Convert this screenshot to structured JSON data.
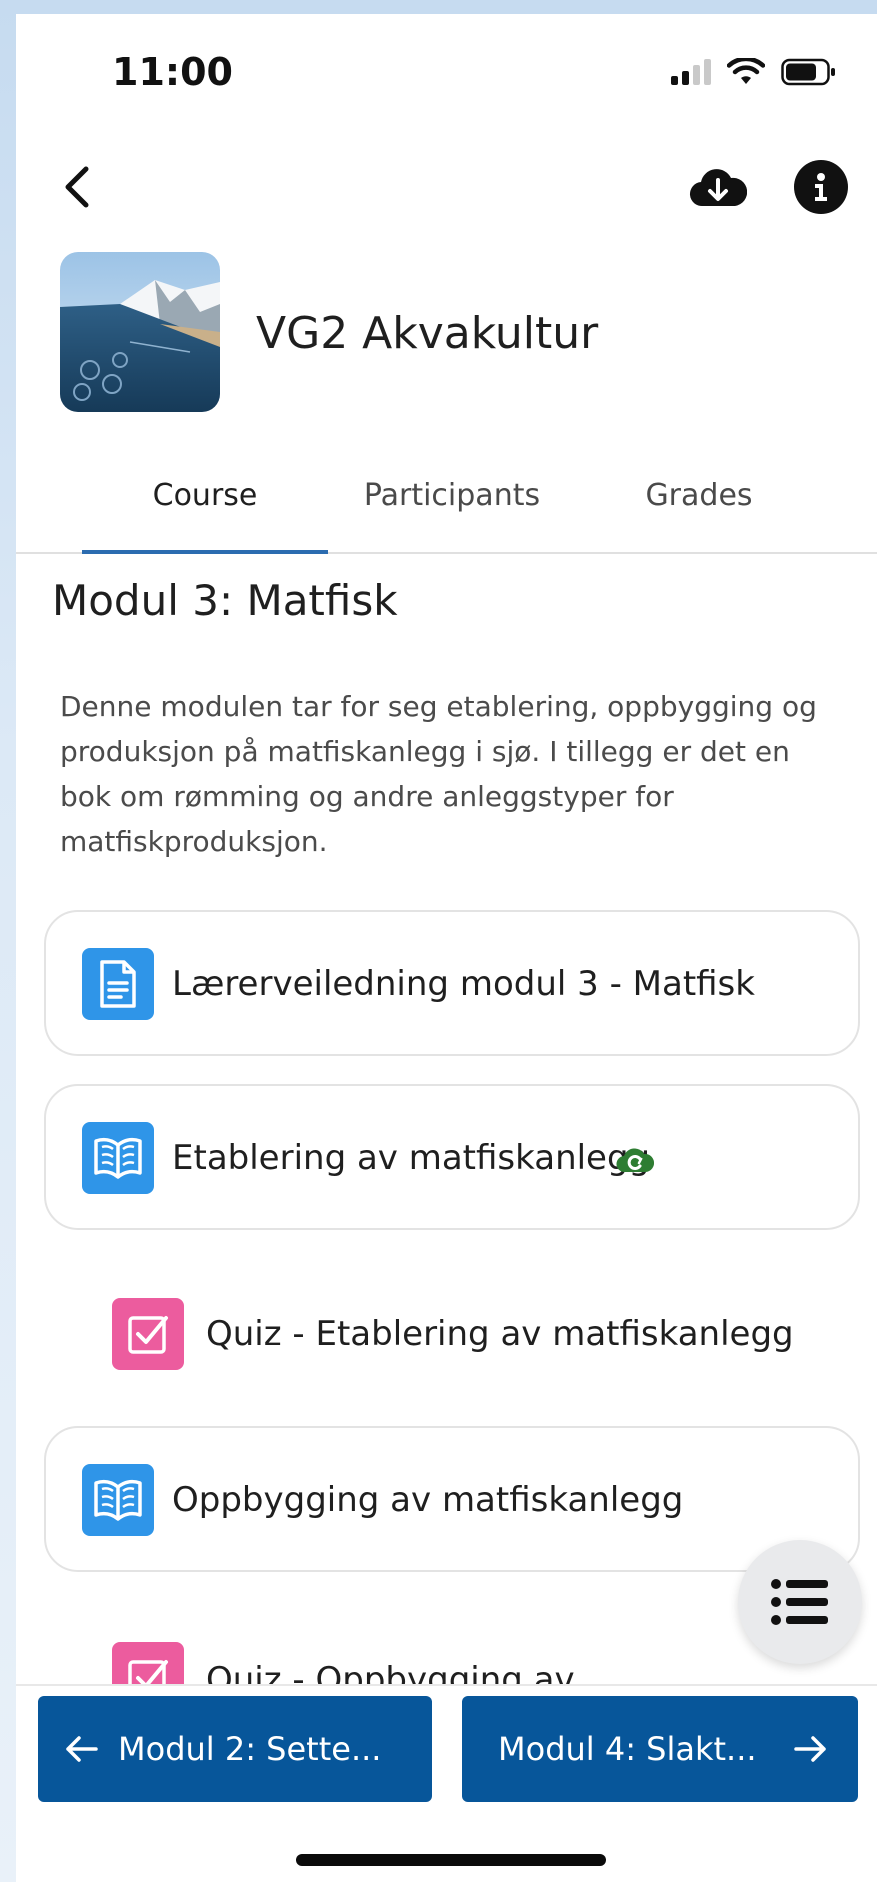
{
  "status_bar": {
    "time": "11:00"
  },
  "toolbar": {
    "back_icon": "chevron-left-icon",
    "download_icon": "cloud-download-icon",
    "info_icon": "info-icon"
  },
  "course": {
    "title": "VG2 Akvakultur"
  },
  "tabs": [
    {
      "label": "Course",
      "active": true
    },
    {
      "label": "Participants",
      "active": false
    },
    {
      "label": "Grades",
      "active": false
    }
  ],
  "section": {
    "title": "Modul 3: Matfisk",
    "description": "Denne modulen tar for seg etablering, oppbygging og produksjon på matfiskanlegg i sjø. I tillegg er det en bok om rømming og andre anleggstyper for matfiskproduksjon."
  },
  "activities": [
    {
      "label": "Lærerveiledning modul 3 - Matfisk",
      "type": "page",
      "icon": "document-icon",
      "color": "#2f95e8"
    },
    {
      "label": "Etablering av matfiskanlegg",
      "type": "book",
      "icon": "book-icon",
      "color": "#2f95e8",
      "badge_icon": "cloud-sync-icon",
      "badge_color": "#2e7d32"
    },
    {
      "label": "Quiz - Etablering av matfiskanlegg",
      "type": "quiz",
      "icon": "quiz-checkbox-icon",
      "color": "#ec5c9e"
    },
    {
      "label": "Oppbygging av matfiskanlegg",
      "type": "book",
      "icon": "book-icon",
      "color": "#2f95e8"
    },
    {
      "label": "Quiz - Oppbygging av",
      "type": "quiz",
      "icon": "quiz-checkbox-icon",
      "color": "#ec5c9e"
    }
  ],
  "navigation": {
    "prev_label": "Modul 2: Sette...",
    "next_label": "Modul 4: Slakt...",
    "accent": "#07569a"
  },
  "fab": {
    "icon": "list-icon"
  }
}
